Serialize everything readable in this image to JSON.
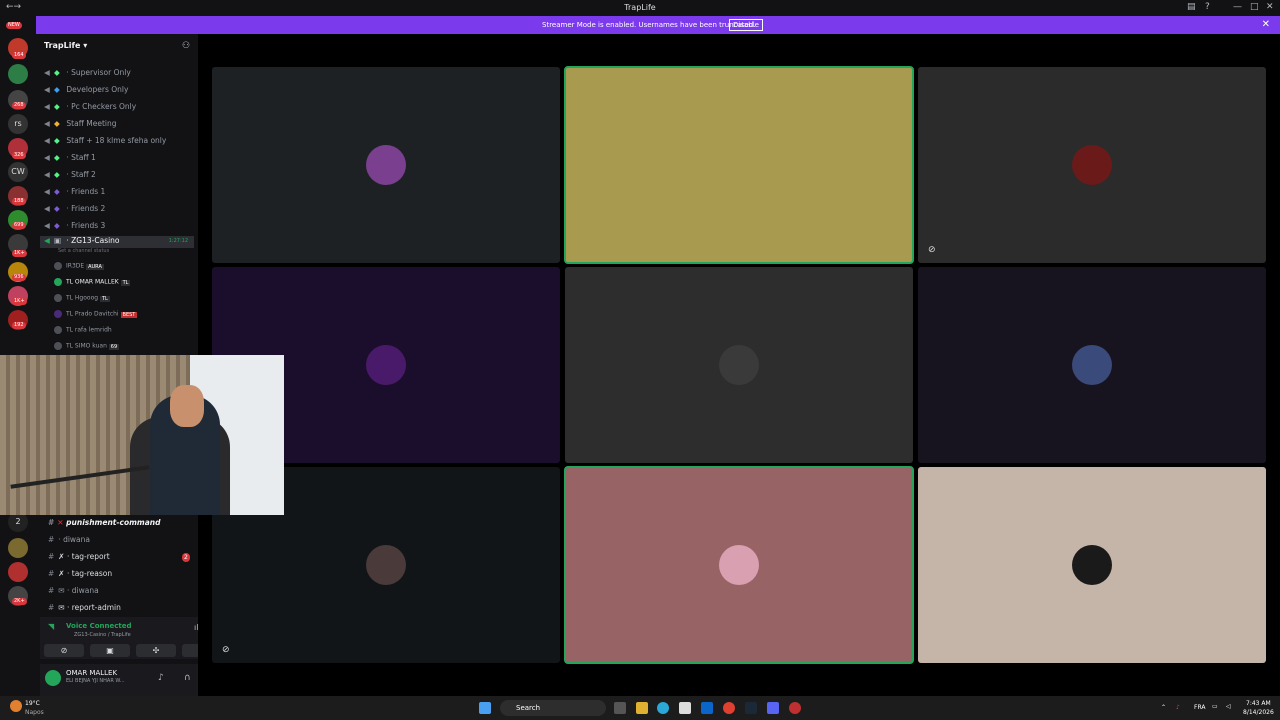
{
  "window": {
    "title": "TrapLife"
  },
  "banner": {
    "message": "Streamer Mode is enabled. Usernames have been truncated.",
    "disable_label": "Disable"
  },
  "guilds": {
    "badges": [
      "NEW",
      "164",
      "268",
      "326",
      "188",
      "699",
      "1K+",
      "936",
      "1K+",
      "192",
      "2",
      "2K+"
    ],
    "labels": [
      "rs",
      "CW",
      "2"
    ]
  },
  "server": {
    "name": "TrapLife"
  },
  "voice_channels": [
    {
      "name": "Supervisor Only"
    },
    {
      "name": "Developers Only"
    },
    {
      "name": "Pc Checkers Only"
    },
    {
      "name": "Staff Meeting"
    },
    {
      "name": "Staff + 18 klme sfeha only"
    },
    {
      "name": "Staff 1"
    },
    {
      "name": "Staff 2"
    },
    {
      "name": "Friends 1"
    },
    {
      "name": "Friends 2"
    },
    {
      "name": "Friends 3"
    }
  ],
  "active_channel": {
    "name": "ZG13-Casino",
    "timer": "1:27:12",
    "status": "Set a channel status"
  },
  "members": [
    {
      "name": "IR3DE",
      "tag": "AURA"
    },
    {
      "name": "TL OMAR MALLEK",
      "tag": "TL"
    },
    {
      "name": "TL Hgooog",
      "tag": "TL"
    },
    {
      "name": "TL Prado Davitchi",
      "tag": "BEST"
    },
    {
      "name": "TL rafa lemridh",
      "tag": ""
    },
    {
      "name": "TL SIMO kuan",
      "tag": "69"
    }
  ],
  "text_channels": [
    {
      "name": "punishment-command",
      "badge": ""
    },
    {
      "name": "diwana",
      "badge": ""
    },
    {
      "name": "tag-report",
      "badge": "2"
    },
    {
      "name": "tag-reason",
      "badge": ""
    },
    {
      "name": "diwana",
      "badge": ""
    },
    {
      "name": "report-admin",
      "badge": ""
    }
  ],
  "voice_panel": {
    "label": "Voice Connected",
    "sub": "ZG13-Casino / TrapLife"
  },
  "user_panel": {
    "name": "OMAR MALLEK",
    "status": "ELI BEJNA YJI NHAR W..."
  },
  "tiles": [
    {
      "bg": "#1e2124",
      "avatar": "#7a3f8f",
      "speaking": false
    },
    {
      "bg": "#a89a4e",
      "avatar": "#a89a4e",
      "speaking": true
    },
    {
      "bg": "#2b2b2b",
      "avatar": "#6b1a1a",
      "speaking": false
    },
    {
      "bg": "#1b0e2c",
      "avatar": "#4a1a6a",
      "speaking": false
    },
    {
      "bg": "#2d2d2d",
      "avatar": "#3a3a3a",
      "speaking": false
    },
    {
      "bg": "#17141f",
      "avatar": "#3a4a7a",
      "speaking": false
    },
    {
      "bg": "#111518",
      "avatar": "#4a3a3a",
      "speaking": false
    },
    {
      "bg": "#986364",
      "avatar": "#d8a0b0",
      "speaking": true
    },
    {
      "bg": "#c4b5a8",
      "avatar": "#1a1a1a",
      "speaking": false
    }
  ],
  "taskbar": {
    "weather_temp": "19°C",
    "weather_loc": "Napos",
    "search": "Search",
    "lang": "FRA",
    "time": "7:43 AM",
    "date": "8/14/2026"
  }
}
